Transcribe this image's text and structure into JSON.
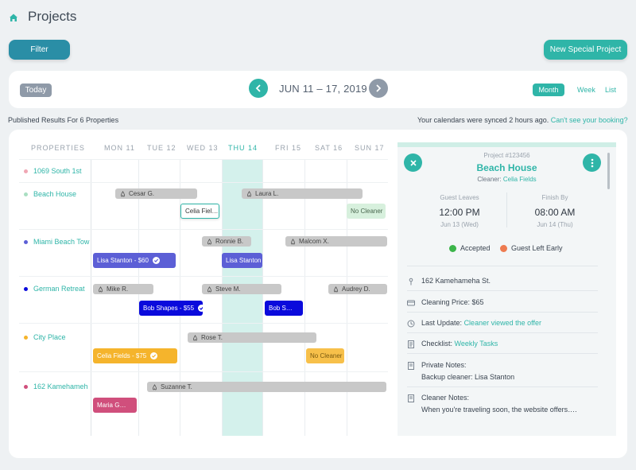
{
  "header": {
    "title": "Projects",
    "filter_label": "Filter",
    "new_project_label": "New Special Project"
  },
  "toolbar": {
    "today_label": "Today",
    "date_range": "JUN 11 – 17, 2019",
    "views": {
      "month": "Month",
      "week": "Week",
      "list": "List"
    }
  },
  "info": {
    "results": "Published Results For 6 Properties",
    "sync": "Your calendars were synced 2 hours ago.",
    "sync_link": "Can't see your booking?"
  },
  "calendar": {
    "properties_header": "PROPERTIES",
    "days": [
      "MON 11",
      "TUE 12",
      "WED 13",
      "THU 14",
      "FRI 15",
      "SAT 16",
      "SUN 17"
    ],
    "properties": [
      {
        "name": "1069 South 1st",
        "color": "#f0a7b4"
      },
      {
        "name": "Beach House",
        "color": "#a9dfc2"
      },
      {
        "name": "Miami Beach Tow",
        "color": "#5c5fd6"
      },
      {
        "name": "German Retreat",
        "color": "#0a0adc"
      },
      {
        "name": "City Place",
        "color": "#f5b42c"
      },
      {
        "name": "162 Kamehameh",
        "color": "#d04f7c"
      }
    ],
    "bookings": [
      "Cesar G.",
      "Laura L.",
      "Celia Fiel…",
      "No Cleaner",
      "Ronnie B.",
      "Malcom X.",
      "Lisa Stanton - $60",
      "Lisa Stanton",
      "Mike R.",
      "Steve M.",
      "Audrey D.",
      "Bob Shapes - $55",
      "Bob S…",
      "Rose T.",
      "Celia Fields - $75",
      "No Cleaner",
      "Suzanne T.",
      "Maria G…"
    ]
  },
  "panel": {
    "project_number": "Project #123456",
    "name": "Beach House",
    "cleaner_label": "Cleaner:",
    "cleaner_name": "Celia Fields",
    "guest_leaves_label": "Guest Leaves",
    "guest_leaves_time": "12:00 PM",
    "guest_leaves_date": "Jun 13 (Wed)",
    "finish_by_label": "Finish By",
    "finish_by_time": "08:00 AM",
    "finish_by_date": "Jun 14 (Thu)",
    "status_accepted": "Accepted",
    "status_guest_left": "Guest Left Early",
    "address": "162 Kamehameha St.",
    "price": "Cleaning Price: $65",
    "last_update_label": "Last Update:",
    "last_update_value": "Cleaner viewed the offer",
    "checklist_label": "Checklist:",
    "checklist_value": "Weekly Tasks",
    "private_notes_label": "Private Notes:",
    "private_notes_value": "Backup cleaner: Lisa Stanton",
    "cleaner_notes_label": "Cleaner Notes:",
    "cleaner_notes_value": "When you're traveling soon, the website offers…."
  },
  "colors": {
    "accent": "#2fb5a8",
    "accepted": "#3cb54a",
    "guest_left": "#ee7b50"
  }
}
